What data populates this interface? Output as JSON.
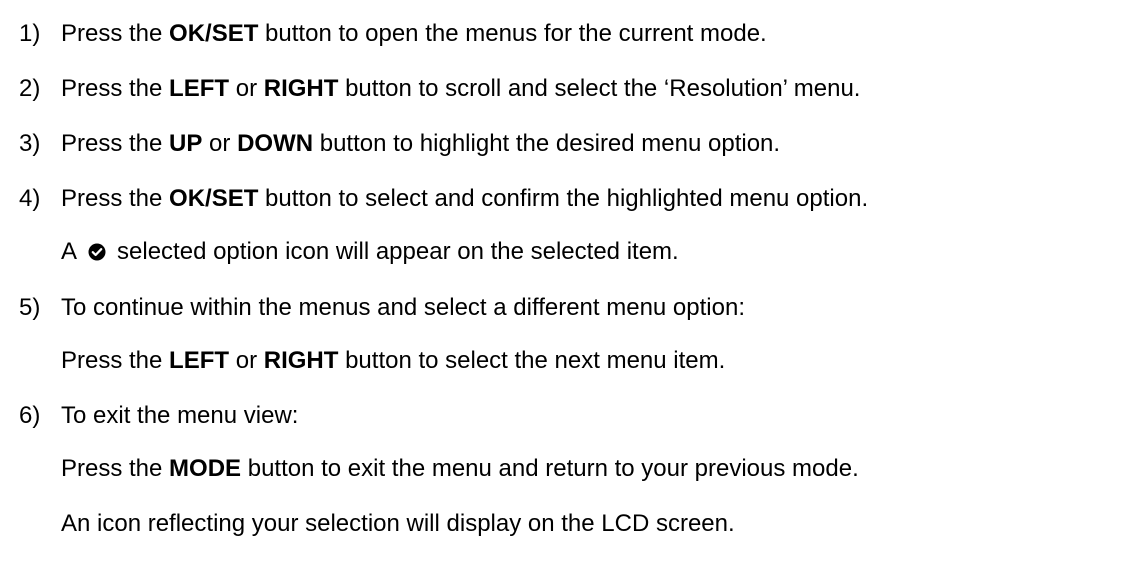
{
  "steps": [
    {
      "number": "1)",
      "pre": "Press the ",
      "key": "OK/SET",
      "post": " button to open the menus for the current mode."
    },
    {
      "number": "2)",
      "pre": "Press the ",
      "key": "LEFT",
      "mid": " or ",
      "key2": "RIGHT",
      "post": " button to scroll and select the ‘Resolution’ menu."
    },
    {
      "number": "3)",
      "pre": "Press the ",
      "key": "UP",
      "mid": " or ",
      "key2": "DOWN",
      "post": " button to highlight the desired menu option."
    },
    {
      "number": "4)",
      "pre": "Press the ",
      "key": "OK/SET",
      "post": " button to select and confirm the highlighted menu option.",
      "note_pre": "A ",
      "note_icon": "check-circle-icon",
      "note_post": " selected option icon will appear on the selected item."
    },
    {
      "number": "5)",
      "text": "To continue within the menus and select a different menu option:",
      "sub_pre": "Press the ",
      "sub_key": "LEFT",
      "sub_mid": " or ",
      "sub_key2": "RIGHT",
      "sub_post": " button to select the next menu item."
    },
    {
      "number": "6)",
      "text": "To exit the menu view:",
      "sub_pre": "Press the ",
      "sub_key": "MODE",
      "sub_post": " button to exit the menu and return to your previous mode.",
      "sub2": "An icon reflecting your selection will display on the LCD screen."
    }
  ]
}
